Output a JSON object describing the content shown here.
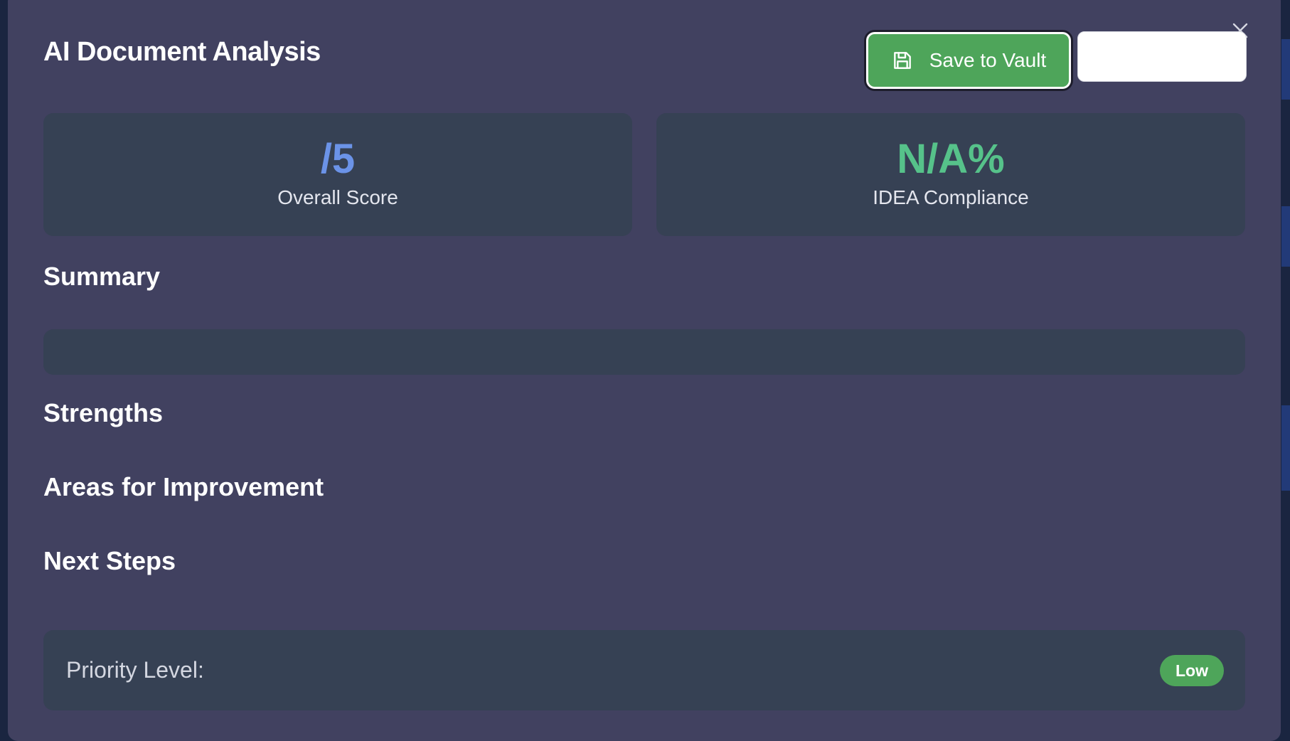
{
  "modal": {
    "title": "AI Document Analysis",
    "close_icon": "close-icon",
    "save_button": {
      "label": "Save to Vault",
      "icon": "save-icon"
    },
    "secondary_button": {
      "label": ""
    }
  },
  "stats": {
    "overall_score": {
      "value": "/5",
      "label": "Overall Score",
      "color": "#6b93e8"
    },
    "idea_compliance": {
      "value": "N/A%",
      "label": "IDEA Compliance",
      "color": "#56c28a"
    }
  },
  "sections": {
    "summary": {
      "heading": "Summary",
      "text": ""
    },
    "strengths": {
      "heading": "Strengths"
    },
    "improvement": {
      "heading": "Areas for Improvement"
    },
    "next_steps": {
      "heading": "Next Steps"
    }
  },
  "priority": {
    "label": "Priority Level:",
    "level": "Low",
    "badge_color": "#4ea55a"
  },
  "colors": {
    "modal_bg": "#414160",
    "card_bg": "#364154",
    "accent_green": "#4ea55a"
  }
}
